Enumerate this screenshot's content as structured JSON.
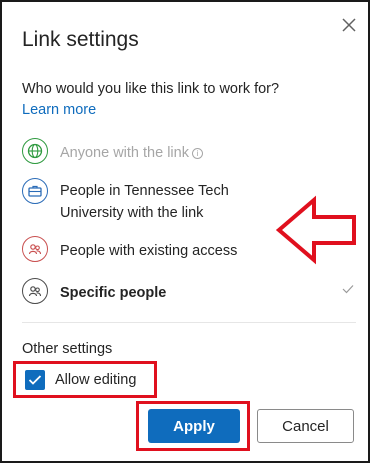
{
  "dialog": {
    "title": "Link settings",
    "question": "Who would you like this link to work for?",
    "learn_more": "Learn more",
    "options": [
      {
        "label": "Anyone with the link",
        "icon": "globe-icon",
        "state": "disabled"
      },
      {
        "label": "People in Tennessee Tech University with the link",
        "icon": "organization-icon",
        "state": "enabled"
      },
      {
        "label": "People with existing access",
        "icon": "people-icon",
        "state": "enabled"
      },
      {
        "label": "Specific people",
        "icon": "specific-people-icon",
        "state": "selected"
      }
    ],
    "other_settings": "Other settings",
    "allow_editing": {
      "label": "Allow editing",
      "checked": true
    },
    "buttons": {
      "apply": "Apply",
      "cancel": "Cancel"
    }
  },
  "colors": {
    "accent": "#0f6cbd",
    "highlight": "#e0101e",
    "globe": "#2e9a3f",
    "org": "#2b6cb7",
    "existing": "#c94f4f"
  },
  "annotations": {
    "arrow_target": "People with existing access"
  }
}
